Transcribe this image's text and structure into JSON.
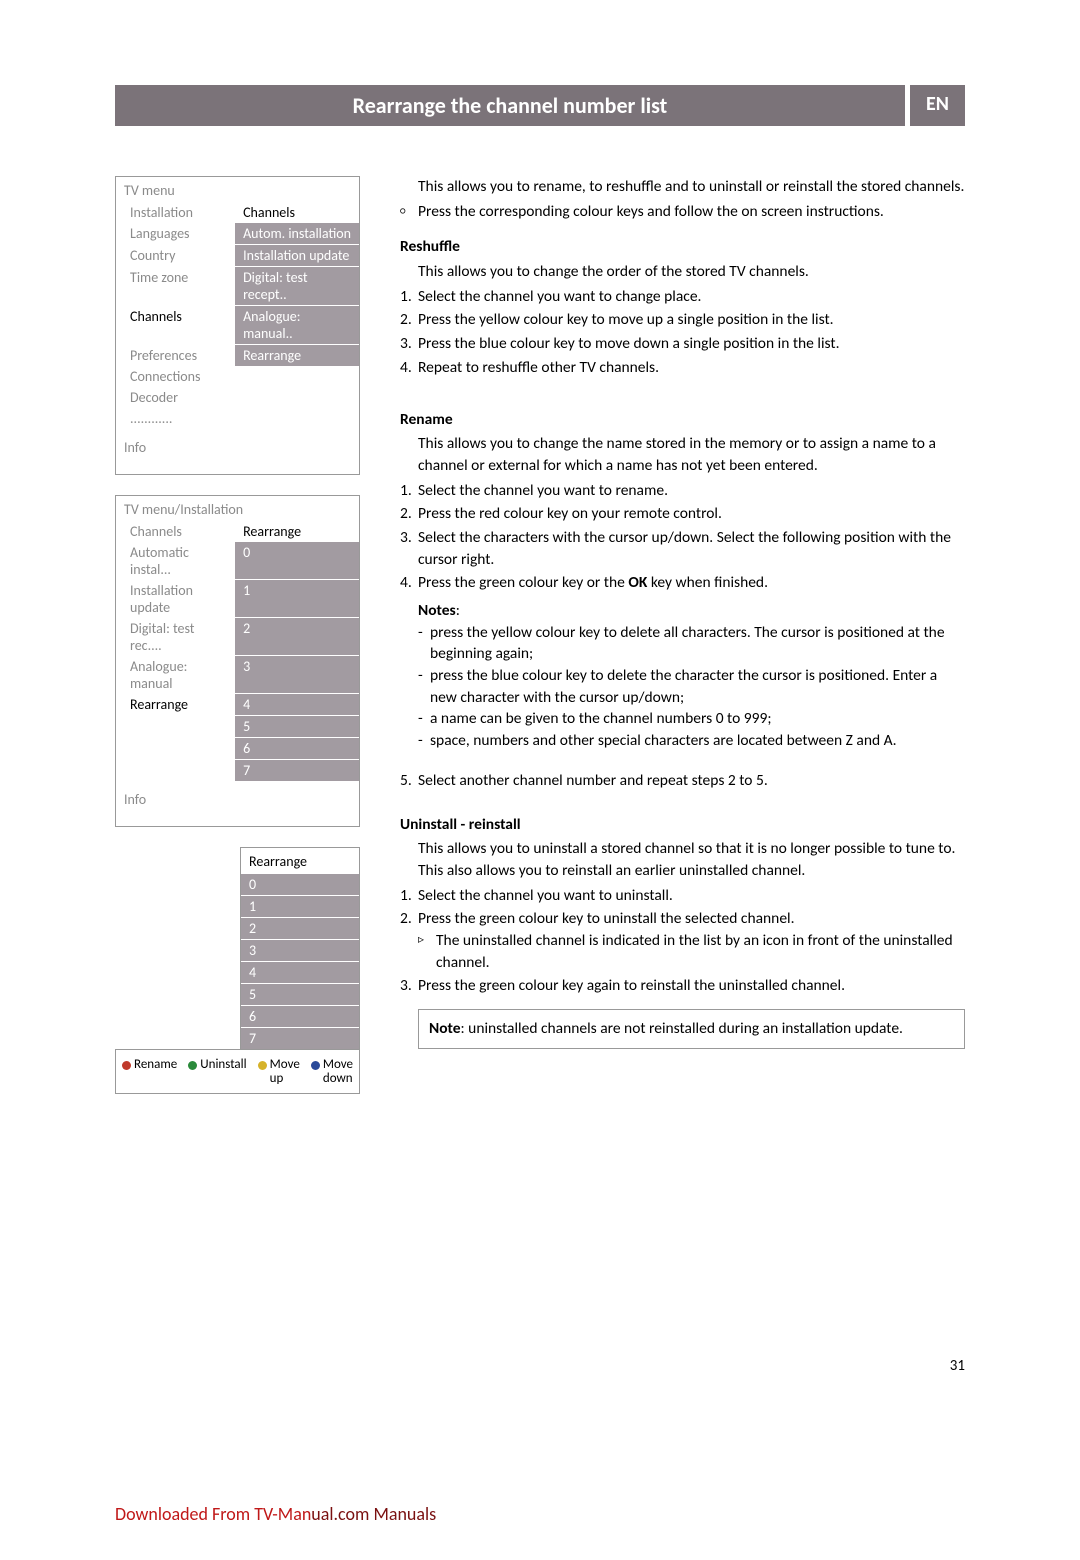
{
  "header": {
    "title": "Rearrange the channel number list",
    "lang": "EN"
  },
  "menu1": {
    "title": "TV menu",
    "left": [
      "Installation",
      "Languages",
      "Country",
      "Time zone",
      "Channels",
      "Preferences",
      "Connections",
      "Decoder",
      "............"
    ],
    "right_header": "Channels",
    "right": [
      "Autom. installation",
      "Installation update",
      "Digital: test recept..",
      "Analogue: manual..",
      "Rearrange"
    ],
    "selected_index": 4,
    "info": "Info"
  },
  "menu2": {
    "title": "TV menu/Installation",
    "left": [
      "Channels",
      "Automatic instal...",
      "Installation update",
      "Digital: test rec....",
      "Analogue: manual",
      "Rearrange"
    ],
    "right_header": "Rearrange",
    "right": [
      "0",
      "1",
      "2",
      "3",
      "4",
      "5",
      "6",
      "7"
    ],
    "selected_index": 5,
    "info": "Info"
  },
  "menu3": {
    "title": "Rearrange",
    "rows": [
      "0",
      "1",
      "2",
      "3",
      "4",
      "5",
      "6",
      "7"
    ]
  },
  "legend": {
    "red": "Rename",
    "green": "Uninstall",
    "yellow": "Move up",
    "blue": "Move down"
  },
  "body": {
    "intro1": "This allows you to rename, to reshuffle and to uninstall or reinstall the stored channels.",
    "intro2": "Press the corresponding colour keys and follow the on screen instructions.",
    "reshuffle_title": "Reshuffle",
    "reshuffle_p": "This allows you to change the order of the stored TV channels.",
    "reshuffle_steps": [
      "Select the channel you want to change place.",
      "Press the yellow colour key  to move up a single position in the list.",
      "Press the blue colour key to move down a single position in the list.",
      "Repeat to reshuffle other TV channels."
    ],
    "rename_title": "Rename",
    "rename_p": "This allows you to change the name stored in the memory or to assign a name to a channel or external for which a name has not yet been entered.",
    "rename_steps": [
      "Select the channel you want to rename.",
      "Press the red colour key on your remote control.",
      "Select the characters with the cursor up/down. Select the following position with the cursor right.",
      "Press the green colour key or the OK key when finished."
    ],
    "rename_step4_prefix": "Press the green colour key or the ",
    "rename_step4_bold": "OK",
    "rename_step4_suffix": " key when finished.",
    "notes_label": "Notes",
    "notes": [
      "press the yellow colour key to delete all characters. The cursor is positioned at the beginning again;",
      "press the blue colour key to delete the character the cursor is positioned. Enter a new character with the cursor up/down;",
      "a name can be given to the channel numbers 0 to 999;",
      "space, numbers and other special characters are located between Z and A."
    ],
    "rename_step5": "Select another channel number and repeat steps 2 to 5.",
    "uninstall_title": "Uninstall - reinstall",
    "uninstall_p": "This allows you to uninstall a stored channel so that it is no longer possible to tune to. This also allows you to reinstall an earlier uninstalled channel.",
    "uninstall_steps": [
      "Select the channel you want to uninstall.",
      "Press the green colour key to uninstall the selected channel.",
      "Press the green colour key again to reinstall the uninstalled channel."
    ],
    "uninstall_sub": "The uninstalled channel is indicated in the list by an icon in front of the uninstalled channel.",
    "note_bottom_label": "Note",
    "note_bottom": ": uninstalled channels are not reinstalled during an installation update."
  },
  "page_number": "31",
  "footer": {
    "red": "Downloaded From TV-Man",
    "dark": "ual.com Manuals"
  }
}
